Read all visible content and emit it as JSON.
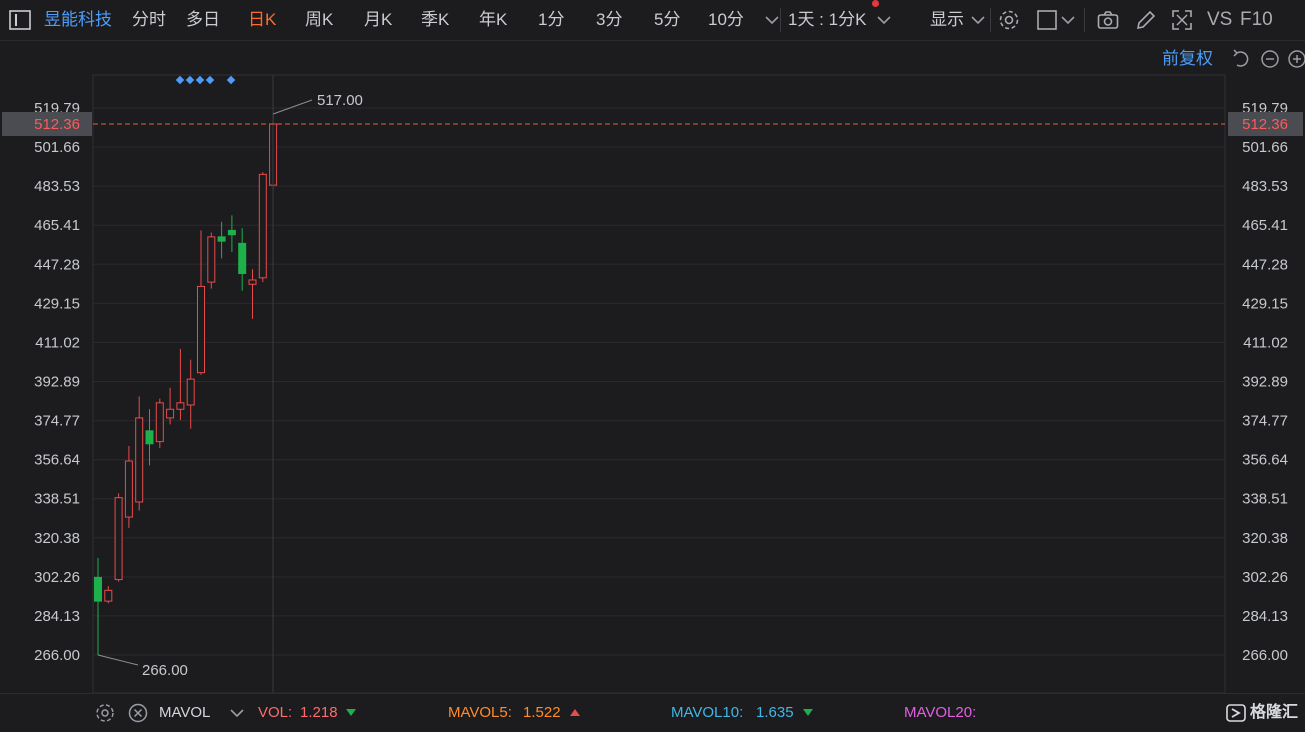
{
  "toolbar": {
    "stock_name": "昱能科技",
    "tabs": [
      "分时",
      "多日",
      "日K",
      "周K",
      "月K",
      "季K",
      "年K",
      "1分",
      "3分",
      "5分",
      "10分"
    ],
    "active_tab": "日K",
    "interval_select": "1天 : 1分K",
    "display_label": "显示",
    "vs_label": "VS",
    "f10_label": "F10"
  },
  "sub_header": {
    "adjust_label": "前复权"
  },
  "colors": {
    "up": "#e84b4b",
    "down": "#1eb04a",
    "grid": "#2a2a2e",
    "axis_text": "#c6c9ce",
    "price_line": "#e2663a",
    "accent_blue": "#4d9cf8"
  },
  "chart_data": {
    "type": "candlestick",
    "y_ticks": [
      "519.79",
      "501.66",
      "483.53",
      "465.41",
      "447.28",
      "429.15",
      "411.02",
      "392.89",
      "374.77",
      "356.64",
      "338.51",
      "320.38",
      "302.26",
      "284.13",
      "266.00"
    ],
    "ylim": [
      266.0,
      519.79
    ],
    "current_price": "512.36",
    "annotations": {
      "high_label": "517.00",
      "low_label": "266.00"
    },
    "candles": [
      {
        "open": 302.0,
        "close": 291.0,
        "high": 311.0,
        "low": 266.0
      },
      {
        "open": 291.0,
        "close": 296.0,
        "high": 298.0,
        "low": 290.0
      },
      {
        "open": 301.0,
        "close": 339.0,
        "high": 341.0,
        "low": 300.0
      },
      {
        "open": 330.0,
        "close": 356.0,
        "high": 363.0,
        "low": 325.0
      },
      {
        "open": 337.0,
        "close": 376.0,
        "high": 386.0,
        "low": 333.0
      },
      {
        "open": 370.0,
        "close": 364.0,
        "high": 380.0,
        "low": 354.0
      },
      {
        "open": 365.0,
        "close": 383.0,
        "high": 385.0,
        "low": 362.0
      },
      {
        "open": 376.0,
        "close": 380.0,
        "high": 390.0,
        "low": 373.0
      },
      {
        "open": 380.0,
        "close": 383.0,
        "high": 408.0,
        "low": 375.0
      },
      {
        "open": 382.0,
        "close": 394.0,
        "high": 403.0,
        "low": 371.0
      },
      {
        "open": 397.0,
        "close": 437.0,
        "high": 463.0,
        "low": 396.0
      },
      {
        "open": 439.0,
        "close": 460.0,
        "high": 462.0,
        "low": 436.0
      },
      {
        "open": 460.0,
        "close": 458.0,
        "high": 467.0,
        "low": 450.0
      },
      {
        "open": 463.0,
        "close": 461.0,
        "high": 470.0,
        "low": 453.0
      },
      {
        "open": 457.0,
        "close": 443.0,
        "high": 464.0,
        "low": 435.0
      },
      {
        "open": 438.0,
        "close": 440.0,
        "high": 445.0,
        "low": 422.0
      },
      {
        "open": 441.0,
        "close": 489.0,
        "high": 490.0,
        "low": 439.0
      },
      {
        "open": 484.0,
        "close": 512.36,
        "high": 517.0,
        "low": 482.0
      }
    ]
  },
  "bottom_bar": {
    "indicator": "MAVOL",
    "vol_label": "VOL:",
    "vol_value": "1.218",
    "mavol5_label": "MAVOL5:",
    "mavol5_value": "1.522",
    "mavol10_label": "MAVOL10:",
    "mavol10_value": "1.635",
    "mavol20_label": "MAVOL20:",
    "watermark": "格隆汇"
  }
}
